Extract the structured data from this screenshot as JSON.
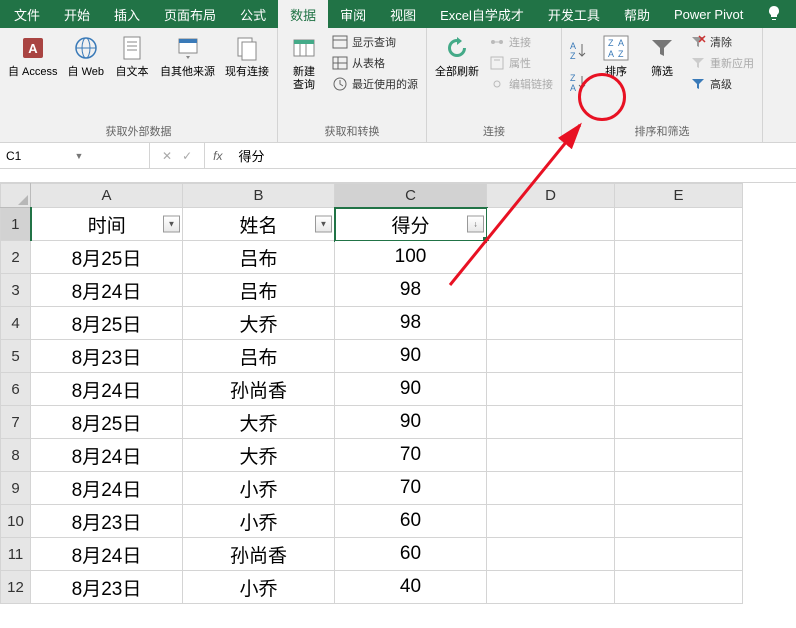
{
  "tabs": {
    "items": [
      "文件",
      "开始",
      "插入",
      "页面布局",
      "公式",
      "数据",
      "审阅",
      "视图",
      "Excel自学成才",
      "开发工具",
      "帮助",
      "Power Pivot"
    ],
    "active": "数据"
  },
  "ribbon": {
    "groups": {
      "external": {
        "label": "获取外部数据",
        "access": "自 Access",
        "web": "自 Web",
        "text": "自文本",
        "other": "自其他来源",
        "existing": "现有连接"
      },
      "transform": {
        "label": "获取和转换",
        "newquery": "新建\n查询",
        "showquery": "显示查询",
        "fromtable": "从表格",
        "recent": "最近使用的源"
      },
      "connections": {
        "label": "连接",
        "refresh": "全部刷新",
        "conn": "连接",
        "props": "属性",
        "editlinks": "编辑链接"
      },
      "sort": {
        "label": "排序和筛选",
        "sort": "排序",
        "filter": "筛选",
        "clear": "清除",
        "reapply": "重新应用",
        "advanced": "高级"
      }
    }
  },
  "formula_bar": {
    "name_box": "C1",
    "value": "得分"
  },
  "sheet": {
    "col_headers": [
      "A",
      "B",
      "C",
      "D",
      "E"
    ],
    "selected_col_index": 2,
    "selected_row_index": 0,
    "header_row": [
      "时间",
      "姓名",
      "得分"
    ],
    "rows": [
      [
        "8月25日",
        "吕布",
        "100"
      ],
      [
        "8月24日",
        "吕布",
        "98"
      ],
      [
        "8月25日",
        "大乔",
        "98"
      ],
      [
        "8月23日",
        "吕布",
        "90"
      ],
      [
        "8月24日",
        "孙尚香",
        "90"
      ],
      [
        "8月25日",
        "大乔",
        "90"
      ],
      [
        "8月24日",
        "大乔",
        "70"
      ],
      [
        "8月24日",
        "小乔",
        "70"
      ],
      [
        "8月23日",
        "小乔",
        "60"
      ],
      [
        "8月24日",
        "孙尚香",
        "60"
      ],
      [
        "8月23日",
        "小乔",
        "40"
      ]
    ]
  }
}
